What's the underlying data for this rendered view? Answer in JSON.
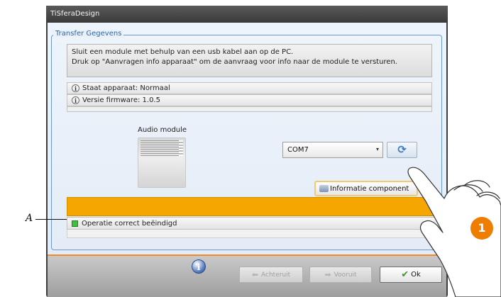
{
  "window": {
    "title": "TiSferaDesign"
  },
  "group": {
    "title": "Transfer Gegevens"
  },
  "info": {
    "line1": "Sluit een module met behulp van een usb kabel aan op de PC.",
    "line2": "Druk op \"Aanvragen info apparaat\" om de aanvraag voor info naar de module te versturen."
  },
  "status": {
    "device_state": "Staat apparaat: Normaal",
    "firmware_version": "Versie firmware: 1.0.5"
  },
  "module": {
    "label": "Audio module"
  },
  "port": {
    "selected": "COM7"
  },
  "buttons": {
    "info_component": "Informatie component",
    "back": "Achteruit",
    "next": "Vooruit",
    "ok": "Ok"
  },
  "progress": {
    "value": 1.0,
    "color": "#f6a600"
  },
  "result": {
    "text": "Operatie correct beëindigd",
    "led_color": "#3fbf3f"
  },
  "annotations": {
    "callout_letter": "A",
    "step_number": "1",
    "badge_color": "#ef7d00"
  },
  "colors": {
    "accent_blue": "#2f66a8",
    "separator_orange": "#f08a2a",
    "focus_border": "#f6c86c"
  },
  "icons": [
    "info-icon",
    "refresh-icon",
    "component-icon",
    "help-icon",
    "back-arrow-icon",
    "next-arrow-icon",
    "checkmark-icon",
    "status-led-icon",
    "pointing-hand-icon"
  ]
}
